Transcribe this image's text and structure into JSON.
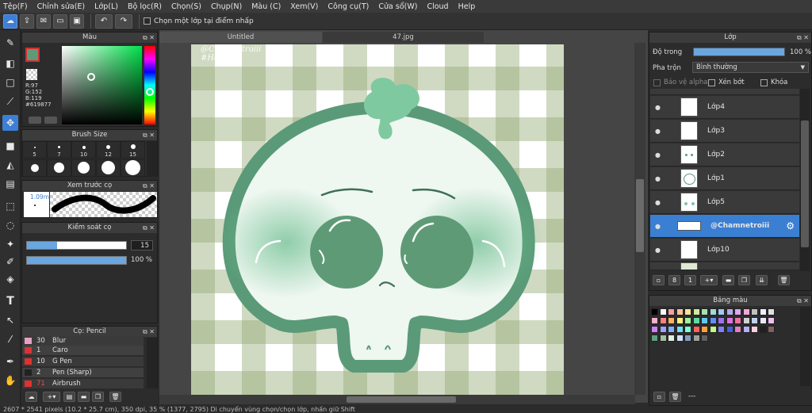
{
  "menu": [
    "Tệp(F)",
    "Chỉnh sửa(E)",
    "Lớp(L)",
    "Bộ lọc(R)",
    "Chọn(S)",
    "Chụp(N)",
    "Màu (C)",
    "Xem(V)",
    "Công cụ(T)",
    "Cửa sổ(W)",
    "Cloud",
    "Help"
  ],
  "toolbar": {
    "pick_layer_label": "Chọn một lớp tại điểm nhấp"
  },
  "tabs": [
    "Untitled",
    "47.jpg"
  ],
  "color_panel": {
    "title": "Màu",
    "r": "R:97",
    "g": "G:152",
    "b": "B:119",
    "hex": "#619877",
    "fg": "#619877"
  },
  "brush_size": {
    "title": "Brush Size",
    "sizes": [
      "5",
      "7",
      "10",
      "12",
      "15"
    ]
  },
  "brush_preview": {
    "title": "Xem trước cọ",
    "size": "1.09mm"
  },
  "brush_control": {
    "title": "Kiểm soát cọ",
    "size_value": "15",
    "opacity_value": "100 %"
  },
  "brush_list": {
    "title": "Cọ: Pencil",
    "items": [
      {
        "num": "30",
        "name": "Blur",
        "color": "#e8a0c0"
      },
      {
        "num": "1",
        "name": "Caro",
        "color": "#e03030"
      },
      {
        "num": "10",
        "name": "G Pen",
        "color": "#e03030"
      },
      {
        "num": "2",
        "name": "Pen (Sharp)",
        "color": "#222222"
      },
      {
        "num": "71",
        "name": "Airbrush",
        "color": "#e03030"
      }
    ]
  },
  "canvas": {
    "watermark_line1": "@Chamnetroiii",
    "watermark_line2": "#Hd247"
  },
  "layers_panel": {
    "title": "Lớp",
    "opacity_label": "Độ trong",
    "opacity_value": "100 %",
    "blend_label": "Pha trộn",
    "blend_value": "Bình thường",
    "protect_alpha": "Bảo vệ alpha",
    "clipping": "Xén bớt",
    "lock": "Khóa",
    "layers": [
      "Lớp4",
      "Lớp3",
      "Lớp2",
      "Lớp1",
      "Lớp5",
      "@Chamnetroiii",
      "Lớp10"
    ]
  },
  "palette": {
    "title": "Bảng màu",
    "footer": "---"
  },
  "status": {
    "text": "2607 * 2541 pixels (10.2 * 25.7 cm), 350 dpi, 35 % (1377, 2795) Di chuyển vùng chọn/chọn lớp, nhấn giữ Shift"
  }
}
